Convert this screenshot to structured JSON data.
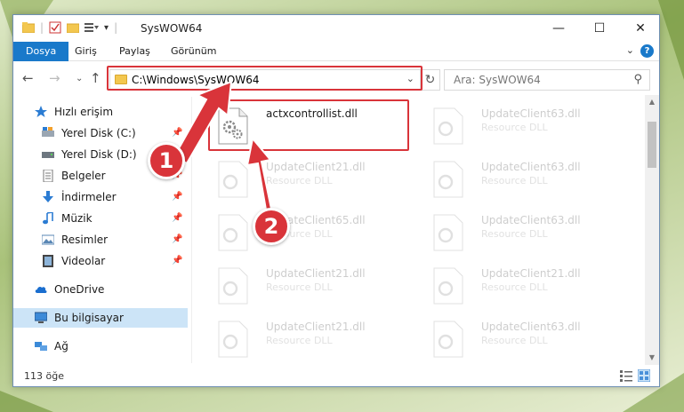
{
  "window": {
    "title": "SysWOW64"
  },
  "ribbon": {
    "tabs": [
      {
        "label": "Dosya"
      },
      {
        "label": "Giriş"
      },
      {
        "label": "Paylaş"
      },
      {
        "label": "Görünüm"
      }
    ],
    "help_label": "?"
  },
  "address": {
    "path": "C:\\Windows\\SysWOW64",
    "search_placeholder": "Ara: SysWOW64"
  },
  "nav": {
    "items": [
      {
        "label": "Hızlı erişim"
      },
      {
        "label": "Yerel Disk (C:)"
      },
      {
        "label": "Yerel Disk (D:)"
      },
      {
        "label": "Belgeler"
      },
      {
        "label": "İndirmeler"
      },
      {
        "label": "Müzik"
      },
      {
        "label": "Resimler"
      },
      {
        "label": "Videolar"
      },
      {
        "label": "OneDrive"
      },
      {
        "label": "Bu bilgisayar"
      },
      {
        "label": "Ağ"
      }
    ]
  },
  "files": {
    "highlighted": {
      "name": "actxcontrollist.dll"
    },
    "faded": [
      {
        "name": "UpdateClient63.dll",
        "type": "Resource DLL"
      },
      {
        "name": "UpdateClient21.dll",
        "type": "Resource DLL"
      },
      {
        "name": "UpdateClient63.dll",
        "type": "Resource DLL"
      },
      {
        "name": "UpdateClient65.dll",
        "type": "Resource DLL"
      },
      {
        "name": "UpdateClient63.dll",
        "type": "Resource DLL"
      },
      {
        "name": "UpdateClient21.dll",
        "type": "Resource DLL"
      },
      {
        "name": "UpdateClient21.dll",
        "type": "Resource DLL"
      },
      {
        "name": "UpdateClient21.dll",
        "type": "Resource DLL"
      },
      {
        "name": "UpdateClient63.dll",
        "type": "Resource DLL"
      }
    ]
  },
  "status": {
    "item_count": "113 öğe"
  },
  "annotations": {
    "step1": "1",
    "step2": "2"
  },
  "colors": {
    "accent": "#1979ca",
    "highlight": "#d9343a",
    "selected": "#cce4f7"
  }
}
